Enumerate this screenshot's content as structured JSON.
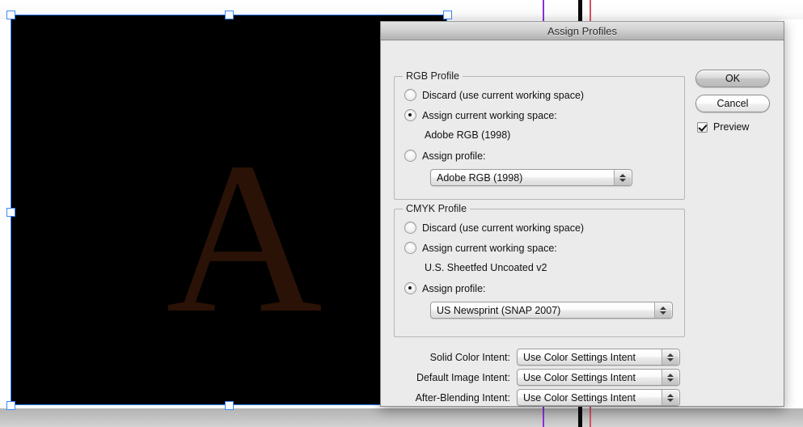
{
  "canvas": {
    "artwork_letter": "A",
    "artwork_color": "#2a1206",
    "artboard_color": "#000000",
    "selection_color": "#2b7df5",
    "guides": [
      {
        "name": "guide-purple",
        "color": "#8e2fd6"
      },
      {
        "name": "guide-black",
        "color": "#0a0a0a"
      },
      {
        "name": "guide-red",
        "color": "#d4505e"
      }
    ]
  },
  "dialog": {
    "title": "Assign Profiles",
    "rgb_group": {
      "title": "RGB Profile",
      "options": [
        {
          "label": "Discard (use current working space)",
          "selected": false
        },
        {
          "label": "Assign current working space:",
          "selected": true
        },
        {
          "label": "Assign profile:",
          "selected": false
        }
      ],
      "working_space_value": "Adobe RGB (1998)",
      "profile_select_value": "Adobe RGB (1998)"
    },
    "cmyk_group": {
      "title": "CMYK Profile",
      "options": [
        {
          "label": "Discard (use current working space)",
          "selected": false
        },
        {
          "label": "Assign current working space:",
          "selected": false
        },
        {
          "label": "Assign profile:",
          "selected": true
        }
      ],
      "working_space_value": "U.S. Sheetfed Uncoated v2",
      "profile_select_value": "US Newsprint (SNAP 2007)"
    },
    "intents": [
      {
        "label": "Solid Color Intent:",
        "value": "Use Color Settings Intent"
      },
      {
        "label": "Default Image Intent:",
        "value": "Use Color Settings Intent"
      },
      {
        "label": "After-Blending Intent:",
        "value": "Use Color Settings Intent"
      }
    ],
    "buttons": {
      "ok": "OK",
      "cancel": "Cancel"
    },
    "preview": {
      "label": "Preview",
      "checked": true
    }
  }
}
